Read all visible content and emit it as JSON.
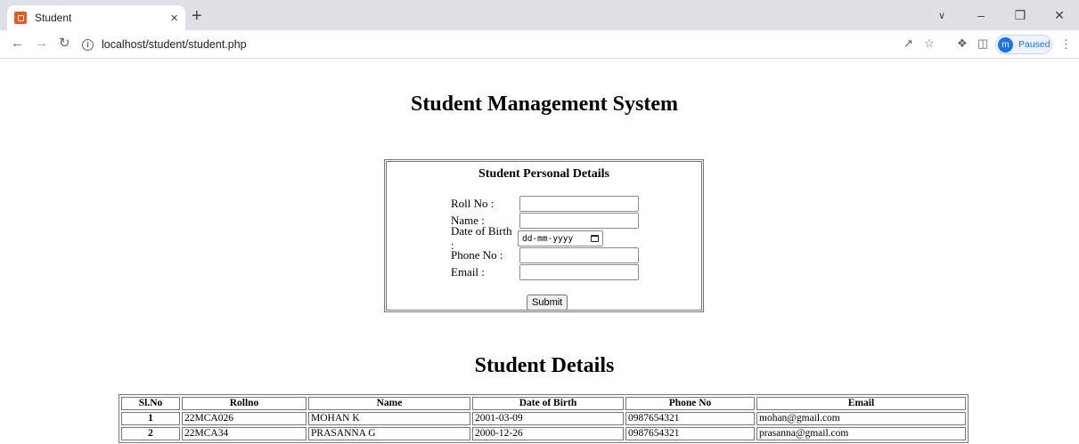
{
  "browser": {
    "tab_title": "Student",
    "tab_close": "×",
    "new_tab": "+",
    "url": "localhost/student/student.php",
    "profile_initial": "m",
    "profile_status": "Paused",
    "icons": [
      "back-icon",
      "forward-icon",
      "reload-icon",
      "info-icon",
      "share-icon",
      "star-icon",
      "extensions-icon",
      "side-panel-icon",
      "menu-icon"
    ]
  },
  "page": {
    "title": "Student Management System",
    "form": {
      "heading": "Student Personal Details",
      "fields": [
        {
          "label": "Roll No :",
          "value": ""
        },
        {
          "label": "Name :",
          "value": ""
        },
        {
          "label": "Date of Birth :",
          "placeholder": "dd-mm-yyyy"
        },
        {
          "label": "Phone No :",
          "value": ""
        },
        {
          "label": "Email :",
          "value": ""
        }
      ],
      "submit_label": "Submit"
    },
    "details": {
      "heading": "Student Details",
      "columns": [
        "Sl.No",
        "Rollno",
        "Name",
        "Date of Birth",
        "Phone No",
        "Email"
      ],
      "rows": [
        [
          "1",
          "22MCA026",
          "MOHAN K",
          "2001-03-09",
          "0987654321",
          "mohan@gmail.com"
        ],
        [
          "2",
          "22MCA34",
          "PRASANNA G",
          "2000-12-26",
          "0987654321",
          "prasanna@gmail.com"
        ]
      ]
    }
  }
}
